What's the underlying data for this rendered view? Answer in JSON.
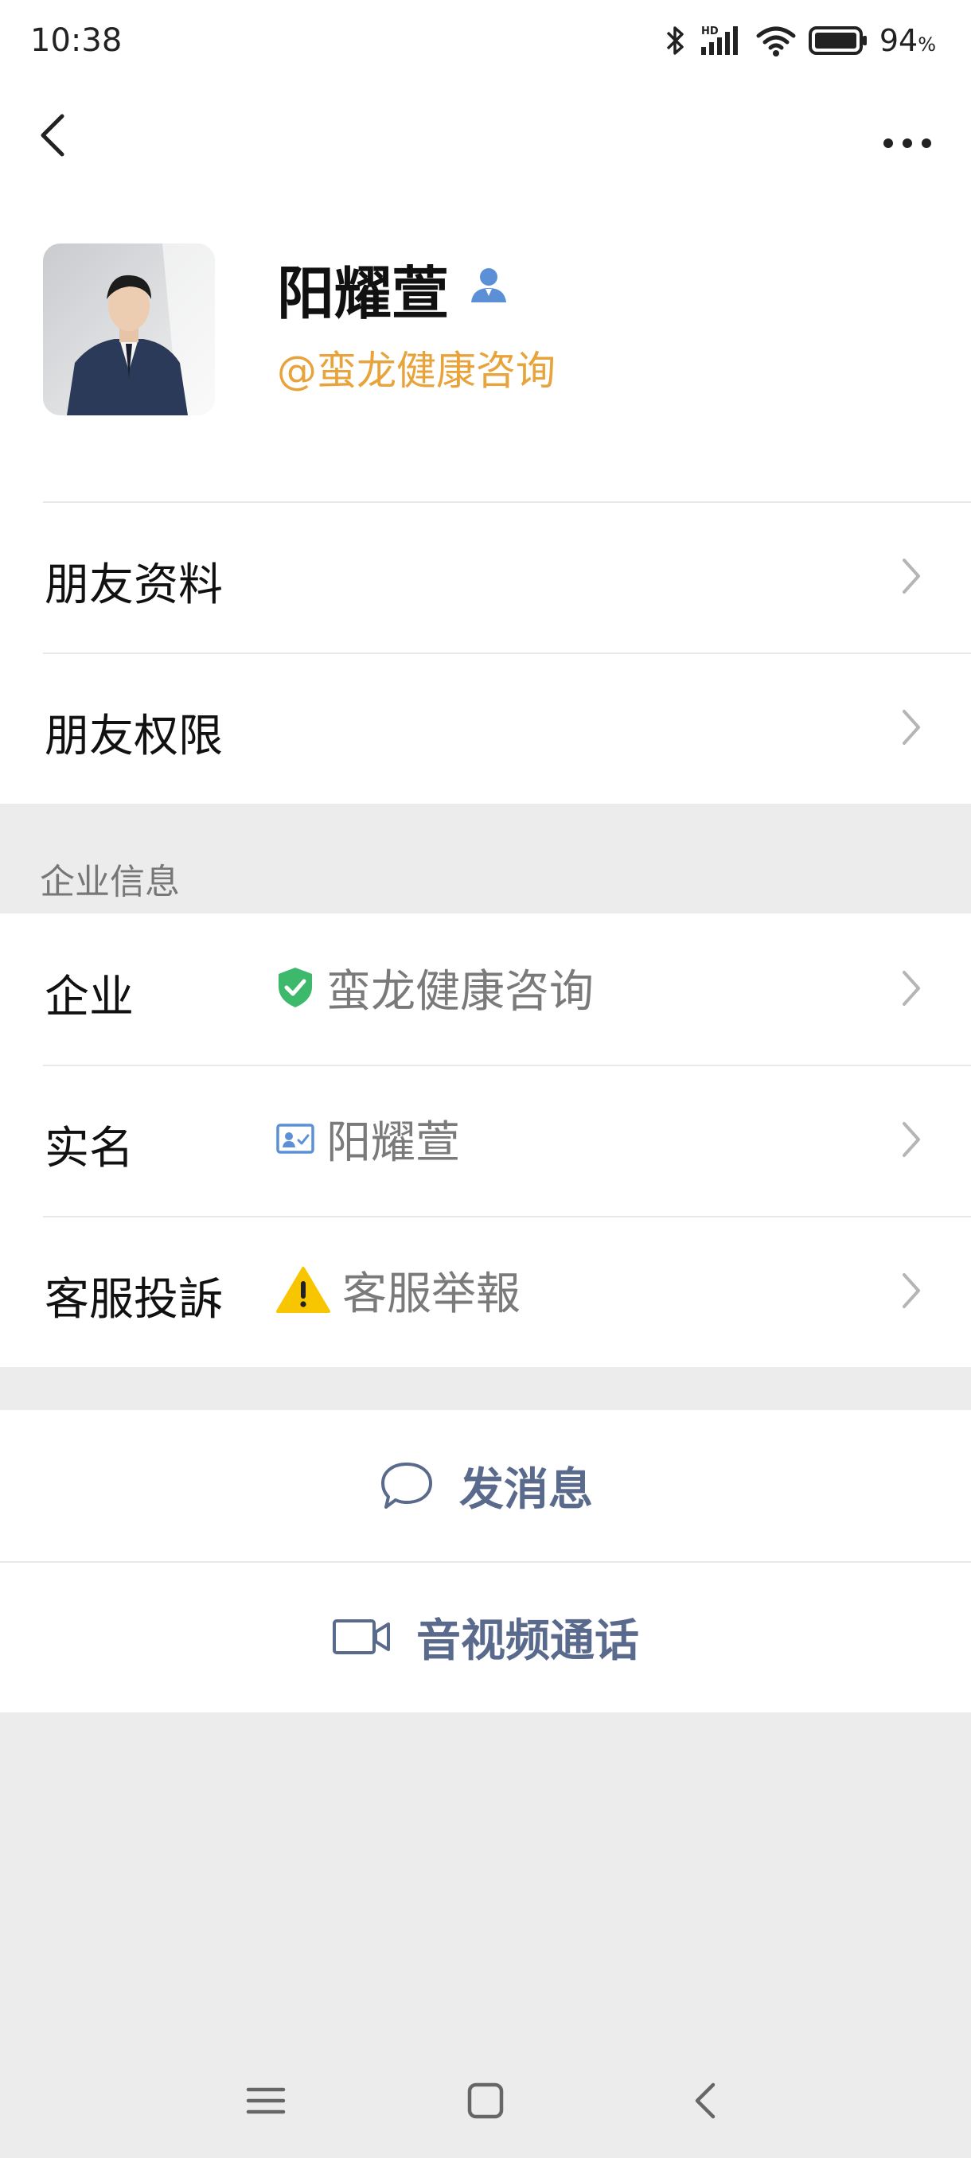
{
  "status": {
    "time": "10:38",
    "battery": "94",
    "battery_unit": "%"
  },
  "profile": {
    "name": "阳耀萱",
    "org": "@蛮龙健康咨询"
  },
  "rows": {
    "friend_profile": "朋友资料",
    "friend_permissions": "朋友权限"
  },
  "section": {
    "enterprise_info": "企业信息"
  },
  "enterprise": {
    "company_label": "企业",
    "company_value": "蛮龙健康咨询",
    "realname_label": "实名",
    "realname_value": "阳耀萱",
    "complaint_label": "客服投訴",
    "complaint_value": "客服举報"
  },
  "actions": {
    "message": "发消息",
    "call": "音视频通话"
  },
  "colors": {
    "org": "#e8a33a",
    "action": "#5a6a8c",
    "verify_green": "#3cb96a",
    "verify_blue": "#5b8fd6"
  },
  "icons": [
    "back-arrow-icon",
    "more-icon",
    "person-icon",
    "shield-check-icon",
    "id-card-icon",
    "warning-icon",
    "chat-bubble-icon",
    "video-camera-icon",
    "chevron-right-icon"
  ]
}
